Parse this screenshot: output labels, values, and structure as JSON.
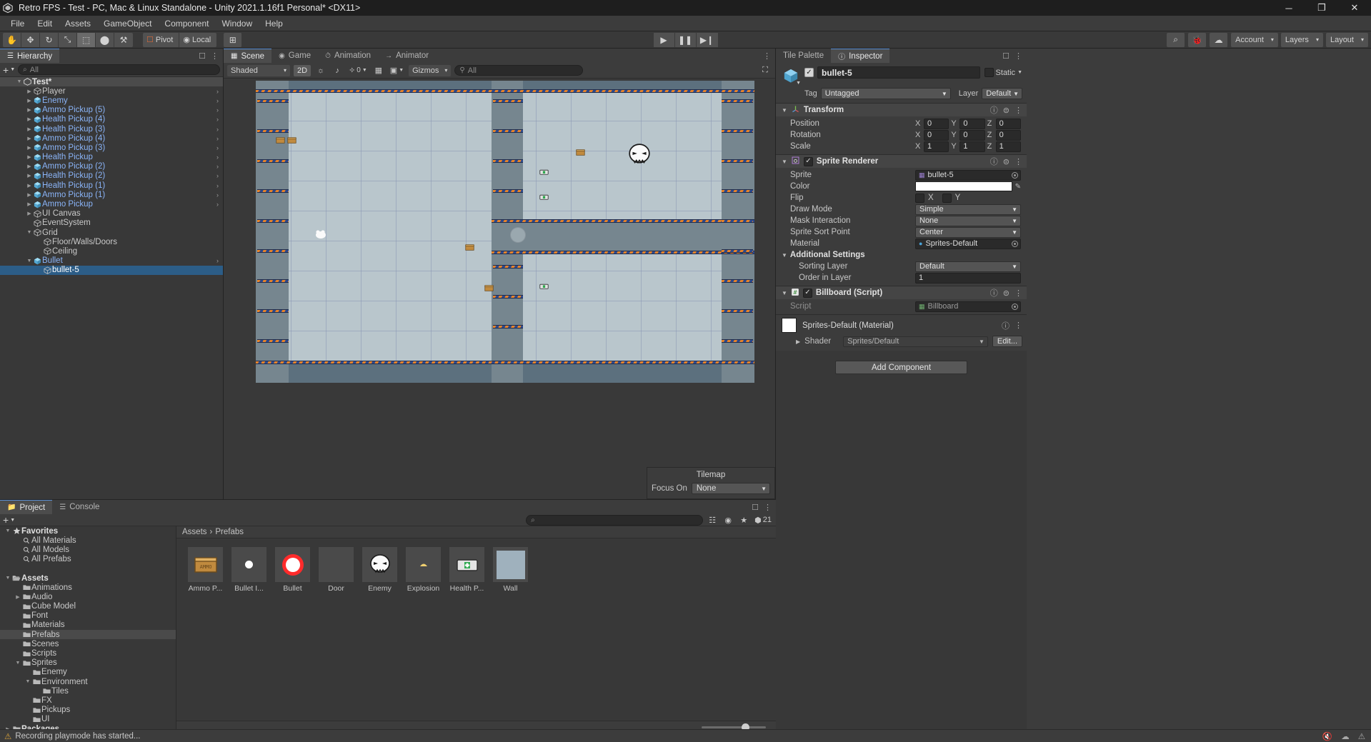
{
  "window": {
    "title": "Retro FPS - Test - PC, Mac & Linux Standalone - Unity 2021.1.16f1 Personal* <DX11>",
    "minimize": "─",
    "maximize": "❐",
    "close": "✕"
  },
  "menu": {
    "items": [
      "File",
      "Edit",
      "Assets",
      "GameObject",
      "Component",
      "Window",
      "Help"
    ]
  },
  "toolbar": {
    "tools": [
      {
        "name": "hand-tool",
        "glyph": "✋"
      },
      {
        "name": "move-tool",
        "glyph": "✥"
      },
      {
        "name": "rotate-tool",
        "glyph": "↻"
      },
      {
        "name": "scale-tool",
        "glyph": "⤡"
      },
      {
        "name": "rect-tool",
        "glyph": "⬚"
      },
      {
        "name": "transform-tool",
        "glyph": "⬤"
      },
      {
        "name": "custom-tool",
        "glyph": "⚒"
      }
    ],
    "pivot_label": "Pivot",
    "local_label": "Local",
    "grid_glyph": "⊞",
    "play_label": "▶",
    "pause_label": "❚❚",
    "step_label": "▶❙",
    "search_glyph": "⌕",
    "collab_glyph": "☁",
    "cloud_glyph": "☁",
    "account_label": "Account",
    "layers_label": "Layers",
    "layout_label": "Layout",
    "caret": "▾"
  },
  "hierarchy": {
    "tab": "Hierarchy",
    "tab_icon": "hierarchy-icon",
    "add_label": "+",
    "search_placeholder": "All",
    "search_glyph": "⌕",
    "nodes": [
      {
        "label": "Test*",
        "depth": 0,
        "arrow": "▼",
        "icon": "none",
        "style": "scene",
        "chev": false
      },
      {
        "label": "Player",
        "depth": 1,
        "arrow": "▶",
        "icon": "cube",
        "style": "plain",
        "chev": true
      },
      {
        "label": "Enemy",
        "depth": 1,
        "arrow": "▶",
        "icon": "prefab",
        "style": "blue",
        "chev": true
      },
      {
        "label": "Ammo Pickup (5)",
        "depth": 1,
        "arrow": "▶",
        "icon": "prefab",
        "style": "blue",
        "chev": true
      },
      {
        "label": "Health Pickup (4)",
        "depth": 1,
        "arrow": "▶",
        "icon": "prefab",
        "style": "blue",
        "chev": true
      },
      {
        "label": "Health Pickup (3)",
        "depth": 1,
        "arrow": "▶",
        "icon": "prefab",
        "style": "blue",
        "chev": true
      },
      {
        "label": "Ammo Pickup (4)",
        "depth": 1,
        "arrow": "▶",
        "icon": "prefab",
        "style": "blue",
        "chev": true
      },
      {
        "label": "Ammo Pickup (3)",
        "depth": 1,
        "arrow": "▶",
        "icon": "prefab",
        "style": "blue",
        "chev": true
      },
      {
        "label": "Health Pickup",
        "depth": 1,
        "arrow": "▶",
        "icon": "prefab",
        "style": "blue",
        "chev": true
      },
      {
        "label": "Ammo Pickup (2)",
        "depth": 1,
        "arrow": "▶",
        "icon": "prefab",
        "style": "blue",
        "chev": true
      },
      {
        "label": "Health Pickup (2)",
        "depth": 1,
        "arrow": "▶",
        "icon": "prefab",
        "style": "blue",
        "chev": true
      },
      {
        "label": "Health Pickup (1)",
        "depth": 1,
        "arrow": "▶",
        "icon": "prefab",
        "style": "blue",
        "chev": true
      },
      {
        "label": "Ammo Pickup (1)",
        "depth": 1,
        "arrow": "▶",
        "icon": "prefab",
        "style": "blue",
        "chev": true
      },
      {
        "label": "Ammo Pickup",
        "depth": 1,
        "arrow": "▶",
        "icon": "prefab",
        "style": "blue",
        "chev": true
      },
      {
        "label": "UI Canvas",
        "depth": 1,
        "arrow": "▶",
        "icon": "cube",
        "style": "plain",
        "chev": false
      },
      {
        "label": "EventSystem",
        "depth": 1,
        "arrow": "",
        "icon": "cube",
        "style": "plain",
        "chev": false
      },
      {
        "label": "Grid",
        "depth": 1,
        "arrow": "▼",
        "icon": "cube",
        "style": "plain",
        "chev": false
      },
      {
        "label": "Floor/Walls/Doors",
        "depth": 2,
        "arrow": "",
        "icon": "cube",
        "style": "plain",
        "chev": false
      },
      {
        "label": "Ceiling",
        "depth": 2,
        "arrow": "",
        "icon": "cube",
        "style": "plain",
        "chev": false
      },
      {
        "label": "Bullet",
        "depth": 1,
        "arrow": "▼",
        "icon": "prefab",
        "style": "blue",
        "chev": true
      },
      {
        "label": "bullet-5",
        "depth": 2,
        "arrow": "",
        "icon": "cube",
        "style": "selected",
        "chev": false
      }
    ]
  },
  "scene": {
    "tabs": [
      {
        "label": "Scene",
        "icon": "scene-icon",
        "active": true
      },
      {
        "label": "Game",
        "icon": "game-icon",
        "active": false
      },
      {
        "label": "Animation",
        "icon": "animation-icon",
        "active": false
      },
      {
        "label": "Animator",
        "icon": "animator-icon",
        "active": false
      }
    ],
    "toolbar": {
      "shading_mode": "Shaded",
      "mode_2d": "2D",
      "light_glyph": "☼",
      "audio_glyph": "♪",
      "fx_glyph": "✧",
      "effects_count": "0",
      "scene_vis_glyph": "▦",
      "camera_glyph": "▣",
      "gizmos_label": "Gizmos",
      "search_placeholder": "All",
      "caret": "▾"
    },
    "tilemap_popup": {
      "title": "Tilemap",
      "focus_label": "Focus On",
      "focus_value": "None"
    }
  },
  "inspector": {
    "tabs": [
      {
        "label": "Tile Palette",
        "active": false
      },
      {
        "label": "Inspector",
        "active": true
      }
    ],
    "object_name": "bullet-5",
    "static_label": "Static",
    "tag_label": "Tag",
    "tag_value": "Untagged",
    "layer_label": "Layer",
    "layer_value": "Default",
    "transform": {
      "title": "Transform",
      "rows": [
        {
          "label": "Position",
          "x": "0",
          "y": "0",
          "z": "0"
        },
        {
          "label": "Rotation",
          "x": "0",
          "y": "0",
          "z": "0"
        },
        {
          "label": "Scale",
          "x": "1",
          "y": "1",
          "z": "1"
        }
      ],
      "axis_x": "X",
      "axis_y": "Y",
      "axis_z": "Z"
    },
    "sprite_renderer": {
      "title": "Sprite Renderer",
      "sprite_label": "Sprite",
      "sprite_value": "bullet-5",
      "color_label": "Color",
      "color_value": "#FFFFFF",
      "flip_label": "Flip",
      "flip_x": "X",
      "flip_y": "Y",
      "draw_mode_label": "Draw Mode",
      "draw_mode_value": "Simple",
      "mask_label": "Mask Interaction",
      "mask_value": "None",
      "sort_point_label": "Sprite Sort Point",
      "sort_point_value": "Center",
      "material_label": "Material",
      "material_value": "Sprites-Default",
      "additional_title": "Additional Settings",
      "sorting_layer_label": "Sorting Layer",
      "sorting_layer_value": "Default",
      "order_label": "Order in Layer",
      "order_value": "1"
    },
    "billboard": {
      "title": "Billboard (Script)",
      "script_label": "Script",
      "script_value": "Billboard"
    },
    "material_block": {
      "title": "Sprites-Default (Material)",
      "shader_label": "Shader",
      "shader_value": "Sprites/Default",
      "edit_label": "Edit..."
    },
    "add_component": "Add Component",
    "help_glyph": "?",
    "preset_glyph": "⇄",
    "menu_glyph": "⋮"
  },
  "project": {
    "tabs": [
      {
        "label": "Project",
        "active": true
      },
      {
        "label": "Console",
        "active": false
      }
    ],
    "add_label": "+",
    "search_placeholder": "",
    "search_glyph": "⌕",
    "item_count": "21",
    "breadcrumbs": [
      "Assets",
      "Prefabs"
    ],
    "breadcrumb_sep": "›",
    "tree": [
      {
        "label": "Favorites",
        "depth": 0,
        "arrow": "▼",
        "icon": "star",
        "bold": true,
        "sel": false
      },
      {
        "label": "All Materials",
        "depth": 1,
        "arrow": "",
        "icon": "search",
        "bold": false,
        "sel": false
      },
      {
        "label": "All Models",
        "depth": 1,
        "arrow": "",
        "icon": "search",
        "bold": false,
        "sel": false
      },
      {
        "label": "All Prefabs",
        "depth": 1,
        "arrow": "",
        "icon": "search",
        "bold": false,
        "sel": false
      },
      {
        "label": "",
        "depth": 0,
        "arrow": "",
        "icon": "spacer",
        "bold": false,
        "sel": false
      },
      {
        "label": "Assets",
        "depth": 0,
        "arrow": "▼",
        "icon": "folder-open",
        "bold": true,
        "sel": false
      },
      {
        "label": "Animations",
        "depth": 1,
        "arrow": "",
        "icon": "folder",
        "bold": false,
        "sel": false
      },
      {
        "label": "Audio",
        "depth": 1,
        "arrow": "▶",
        "icon": "folder",
        "bold": false,
        "sel": false
      },
      {
        "label": "Cube Model",
        "depth": 1,
        "arrow": "",
        "icon": "folder",
        "bold": false,
        "sel": false
      },
      {
        "label": "Font",
        "depth": 1,
        "arrow": "",
        "icon": "folder",
        "bold": false,
        "sel": false
      },
      {
        "label": "Materials",
        "depth": 1,
        "arrow": "",
        "icon": "folder",
        "bold": false,
        "sel": false
      },
      {
        "label": "Prefabs",
        "depth": 1,
        "arrow": "",
        "icon": "folder",
        "bold": false,
        "sel": true
      },
      {
        "label": "Scenes",
        "depth": 1,
        "arrow": "",
        "icon": "folder",
        "bold": false,
        "sel": false
      },
      {
        "label": "Scripts",
        "depth": 1,
        "arrow": "",
        "icon": "folder",
        "bold": false,
        "sel": false
      },
      {
        "label": "Sprites",
        "depth": 1,
        "arrow": "▼",
        "icon": "folder",
        "bold": false,
        "sel": false
      },
      {
        "label": "Enemy",
        "depth": 2,
        "arrow": "",
        "icon": "folder",
        "bold": false,
        "sel": false
      },
      {
        "label": "Environment",
        "depth": 2,
        "arrow": "▼",
        "icon": "folder",
        "bold": false,
        "sel": false
      },
      {
        "label": "Tiles",
        "depth": 3,
        "arrow": "",
        "icon": "folder",
        "bold": false,
        "sel": false
      },
      {
        "label": "FX",
        "depth": 2,
        "arrow": "",
        "icon": "folder",
        "bold": false,
        "sel": false
      },
      {
        "label": "Pickups",
        "depth": 2,
        "arrow": "",
        "icon": "folder",
        "bold": false,
        "sel": false
      },
      {
        "label": "UI",
        "depth": 2,
        "arrow": "",
        "icon": "folder",
        "bold": false,
        "sel": false
      },
      {
        "label": "Packages",
        "depth": 0,
        "arrow": "▶",
        "icon": "folder",
        "bold": true,
        "sel": false
      }
    ],
    "assets": [
      {
        "name": "Ammo P...",
        "icon": "ammo-crate-icon"
      },
      {
        "name": "Bullet I...",
        "icon": "bullet-impact-icon"
      },
      {
        "name": "Bullet",
        "icon": "bullet-icon"
      },
      {
        "name": "Door",
        "icon": "door-icon"
      },
      {
        "name": "Enemy",
        "icon": "enemy-skull-icon"
      },
      {
        "name": "Explosion",
        "icon": "explosion-icon"
      },
      {
        "name": "Health P...",
        "icon": "health-pack-icon"
      },
      {
        "name": "Wall",
        "icon": "wall-icon"
      }
    ]
  },
  "status": {
    "message": "Recording playmode has started...",
    "icons": [
      "mute-icon",
      "cloud-icon",
      "error-icon"
    ]
  }
}
